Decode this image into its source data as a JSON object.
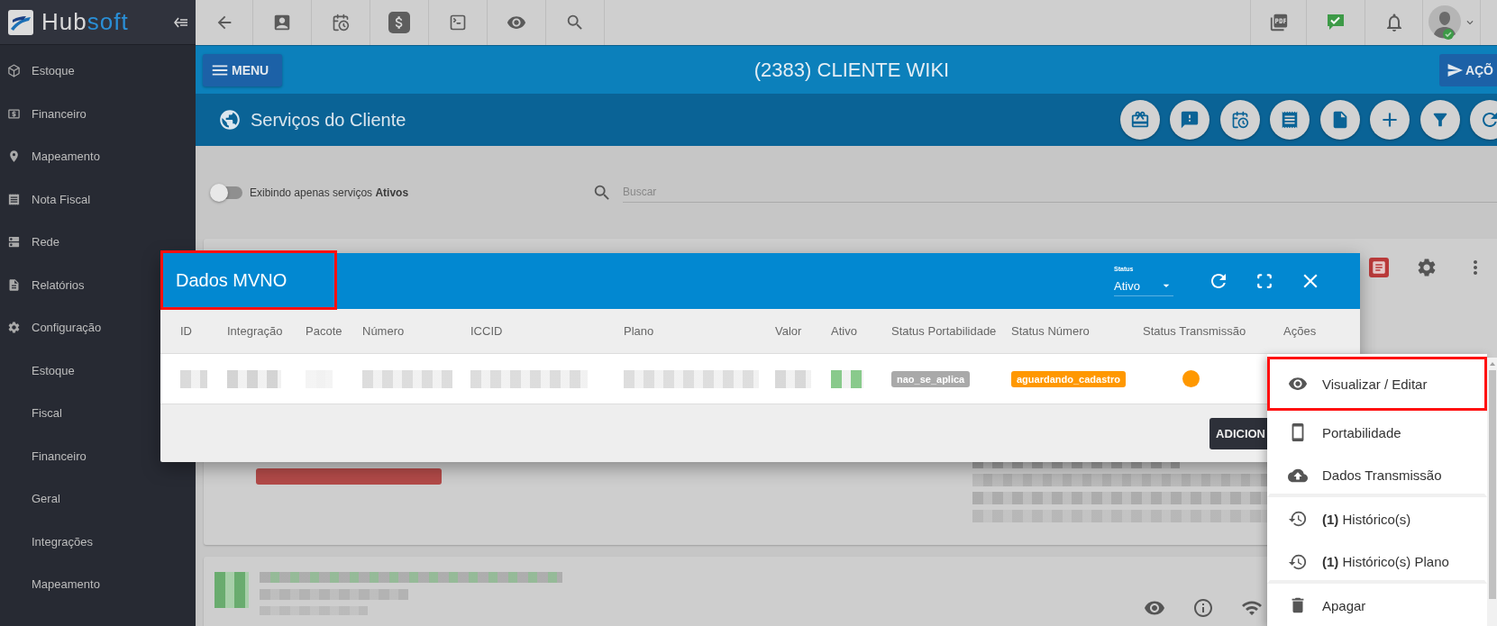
{
  "sidebar": {
    "logo": {
      "part_1": "Hub",
      "part_2": "soft"
    },
    "items": [
      {
        "label": "Estoque"
      },
      {
        "label": "Financeiro"
      },
      {
        "label": "Mapeamento"
      },
      {
        "label": "Nota Fiscal"
      },
      {
        "label": "Rede"
      },
      {
        "label": "Relatórios"
      },
      {
        "label": "Configuração",
        "children": [
          {
            "label": "Estoque"
          },
          {
            "label": "Fiscal"
          },
          {
            "label": "Financeiro"
          },
          {
            "label": "Geral"
          },
          {
            "label": "Integrações"
          },
          {
            "label": "Mapeamento"
          }
        ]
      }
    ]
  },
  "header": {
    "menu_button": "MENU",
    "title": "(2383) CLIENTE WIKI",
    "actions_button": "AÇÕ"
  },
  "services": {
    "title": "Serviços do Cliente"
  },
  "filter": {
    "toggle": {
      "on": false,
      "label": "Exibindo apenas serviços **Ativos**"
    },
    "search": {
      "placeholder": "Buscar"
    }
  },
  "modal": {
    "title": "Dados MVNO",
    "title_highlighted": true,
    "status": {
      "label": "Status",
      "value": "Ativo"
    },
    "columns": [
      "ID",
      "Integração",
      "Pacote",
      "Número",
      "ICCID",
      "Plano",
      "Valor",
      "Ativo",
      "Status Portabilidade",
      "Status Número",
      "Status Transmissão",
      "Ações"
    ],
    "rows": [
      {
        "cells": [
          {
            "kind": "masked",
            "color": "#d6d6d6"
          },
          {
            "kind": "masked",
            "color": "#cfcfcf"
          },
          {
            "kind": "masked",
            "color": "#f3f3f3"
          },
          {
            "kind": "masked",
            "color": "#d9d9d9"
          },
          {
            "kind": "masked",
            "color": "#d9d9d9"
          },
          {
            "kind": "masked",
            "color": "#dadada"
          },
          {
            "kind": "masked",
            "color": "#d4d4d4"
          },
          {
            "kind": "masked",
            "color": "#7cc47f"
          },
          {
            "kind": "badge",
            "text": "nao_se_aplica",
            "color": "#a9a9a9"
          },
          {
            "kind": "badge",
            "text": "aguardando_cadastro",
            "color": "#ff9800"
          },
          {
            "kind": "dot",
            "color": "#ff9800"
          }
        ]
      }
    ],
    "add_button": "ADICION"
  },
  "actions_menu": {
    "items": [
      {
        "label": "Visualizar / Editar",
        "highlighted": true,
        "divider_after": false
      },
      {
        "label": "Portabilidade",
        "highlighted": false,
        "divider_after": false
      },
      {
        "label": "Dados Transmissão",
        "highlighted": false,
        "divider_after": true
      },
      {
        "label": "**(1)** Histórico(s)",
        "highlighted": false,
        "divider_after": false
      },
      {
        "label": "**(1)** Histórico(s) Plano",
        "highlighted": false,
        "divider_after": true
      },
      {
        "label": "Apagar",
        "highlighted": false,
        "divider_after": false
      }
    ]
  }
}
